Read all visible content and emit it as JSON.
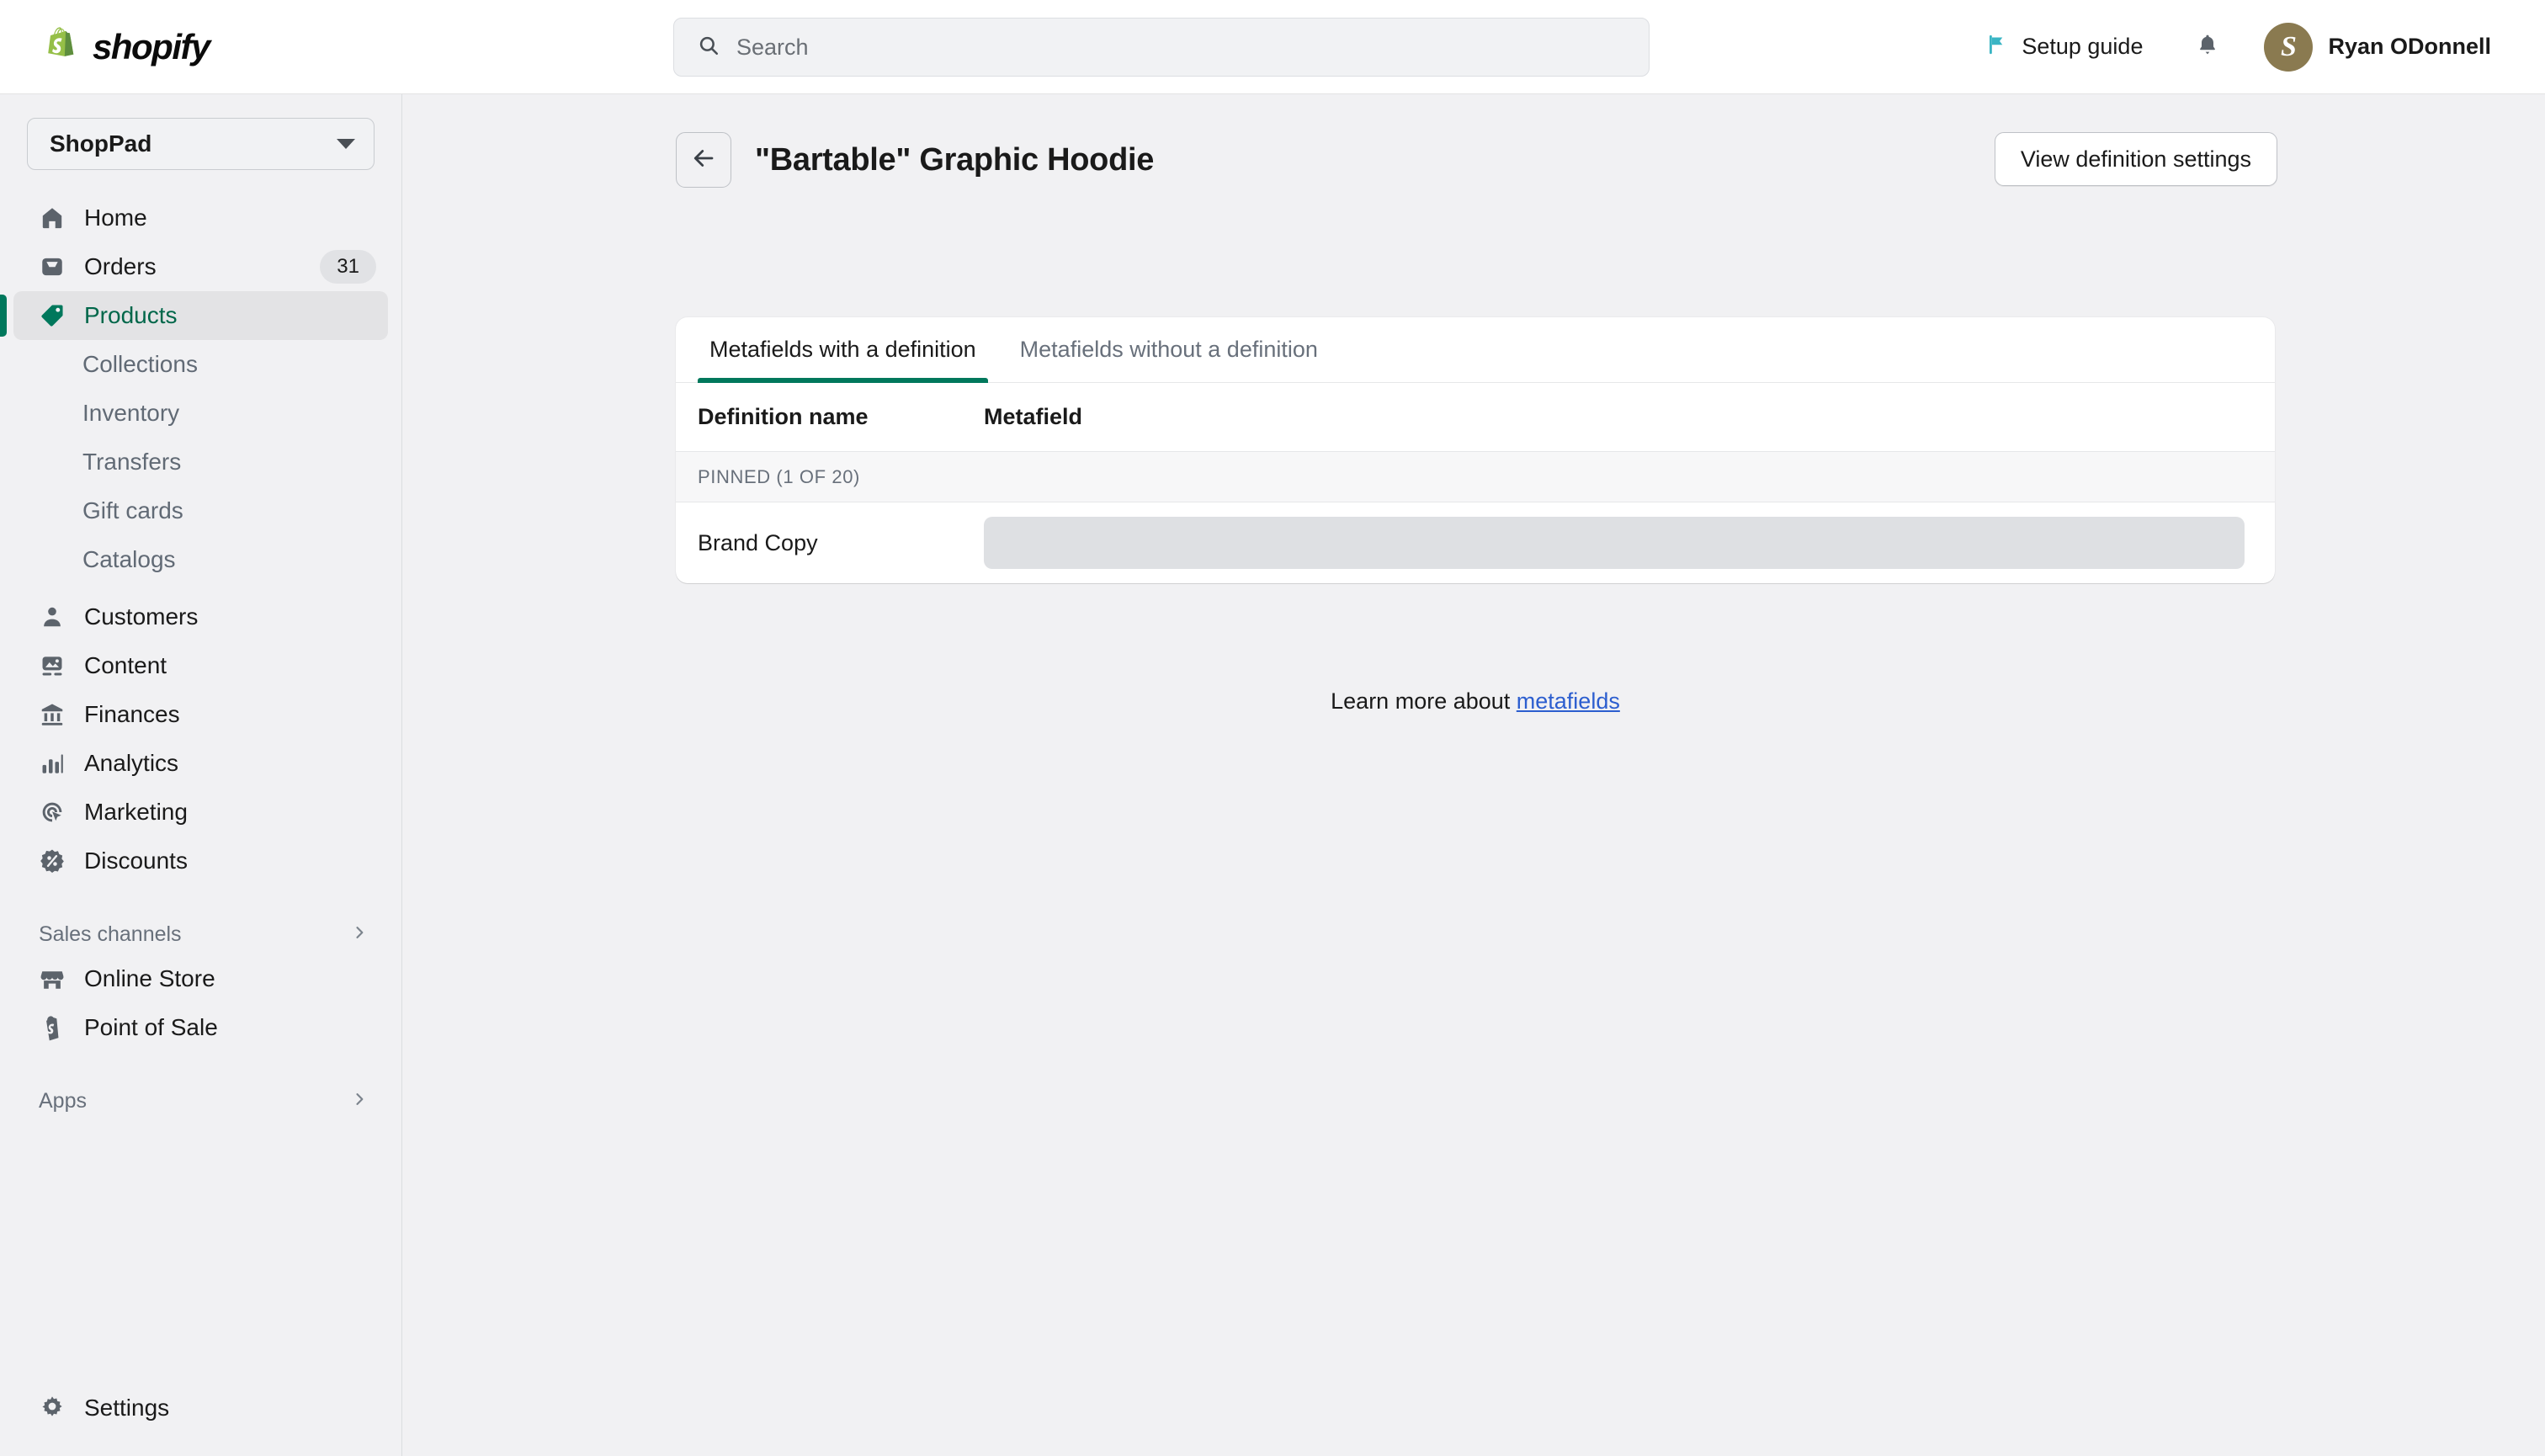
{
  "topbar": {
    "logo_text": "shopify",
    "logo_icon": "shopify-bag-icon",
    "search": {
      "placeholder": "Search",
      "value": "",
      "icon": "search-icon"
    },
    "setup_guide": {
      "label": "Setup guide",
      "icon": "flag-icon"
    },
    "notifications": {
      "icon": "bell-icon"
    },
    "user": {
      "name": "Ryan ODonnell",
      "avatar_initial": "S",
      "avatar_color": "#8A7A50"
    }
  },
  "sidebar": {
    "store": {
      "name": "ShopPad",
      "caret_icon": "chevron-down-icon"
    },
    "items": [
      {
        "label": "Home",
        "icon": "home-icon",
        "badge": null,
        "active": false
      },
      {
        "label": "Orders",
        "icon": "orders-icon",
        "badge": "31",
        "active": false
      },
      {
        "label": "Products",
        "icon": "product-tag-icon",
        "badge": null,
        "active": true
      }
    ],
    "product_subitems": [
      {
        "label": "Collections"
      },
      {
        "label": "Inventory"
      },
      {
        "label": "Transfers"
      },
      {
        "label": "Gift cards"
      },
      {
        "label": "Catalogs"
      }
    ],
    "items2": [
      {
        "label": "Customers",
        "icon": "person-icon"
      },
      {
        "label": "Content",
        "icon": "image-icon"
      },
      {
        "label": "Finances",
        "icon": "bank-icon"
      },
      {
        "label": "Analytics",
        "icon": "bar-chart-icon"
      },
      {
        "label": "Marketing",
        "icon": "marketing-target-icon"
      },
      {
        "label": "Discounts",
        "icon": "discount-percent-icon"
      }
    ],
    "sales_channels": {
      "label": "Sales channels",
      "chevron_icon": "chevron-right-icon"
    },
    "channels": [
      {
        "label": "Online Store",
        "icon": "storefront-icon"
      },
      {
        "label": "Point of Sale",
        "icon": "pos-bag-icon"
      }
    ],
    "apps": {
      "label": "Apps",
      "chevron_icon": "chevron-right-icon"
    },
    "settings": {
      "label": "Settings",
      "icon": "gear-icon"
    },
    "accent_color": "#00785C"
  },
  "main": {
    "back_button": {
      "icon": "arrow-left-icon"
    },
    "page_title": "\"Bartable\" Graphic Hoodie",
    "definition_settings_button": "View definition settings",
    "tabs": [
      {
        "label": "Metafields with a definition",
        "active": true
      },
      {
        "label": "Metafields without a definition",
        "active": false
      }
    ],
    "table": {
      "columns": [
        "Definition name",
        "Metafield"
      ],
      "group_label": "PINNED (1 OF 20)",
      "rows": [
        {
          "name": "Brand Copy",
          "value": "",
          "state": "loading"
        }
      ]
    },
    "footer": {
      "text": "Learn more about ",
      "link_label": "metafields"
    }
  }
}
